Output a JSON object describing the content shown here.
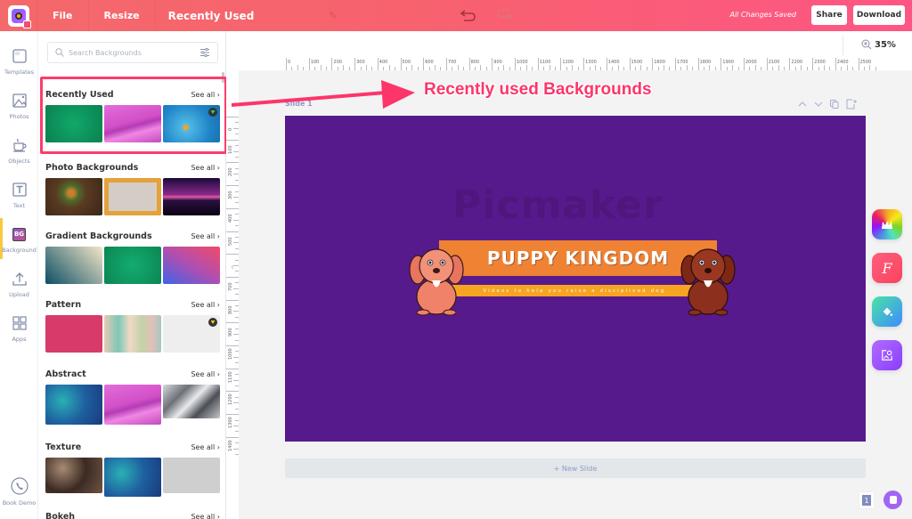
{
  "topbar": {
    "menu": [
      "File",
      "Resize"
    ],
    "title": "Recently Used",
    "save_status": "All Changes Saved",
    "share_label": "Share",
    "download_label": "Download",
    "brand_gradient": [
      "#f4696b",
      "#fe5684"
    ]
  },
  "leftnav": {
    "items": [
      {
        "label": "Templates",
        "icon": "templates-icon"
      },
      {
        "label": "Photos",
        "icon": "photos-icon"
      },
      {
        "label": "Objects",
        "icon": "objects-icon"
      },
      {
        "label": "Text",
        "icon": "text-icon"
      },
      {
        "label": "Background",
        "icon": "background-icon",
        "badge": "BG",
        "active": true
      },
      {
        "label": "Upload",
        "icon": "upload-icon"
      },
      {
        "label": "Apps",
        "icon": "apps-icon"
      }
    ],
    "book_demo": "Book Demo",
    "active_color": "#f8c93e"
  },
  "panel": {
    "search_placeholder": "Search Backgrounds",
    "see_all": "See all",
    "sections": [
      {
        "title": "Recently Used",
        "thumbs": [
          "green-gradient",
          "pink-dunes",
          "blue-3d-premium"
        ]
      },
      {
        "title": "Photo Backgrounds",
        "thumbs": [
          "wood-food",
          "leaf-frame",
          "purple-sunset"
        ]
      },
      {
        "title": "Gradient Backgrounds",
        "thumbs": [
          "teal-cream",
          "green-radial",
          "pink-blue"
        ]
      },
      {
        "title": "Pattern",
        "thumbs": [
          "pink-texture",
          "paint-drips",
          "white-paper-premium"
        ]
      },
      {
        "title": "Abstract",
        "thumbs": [
          "blue-paint",
          "pink-dunes",
          "silver-polygons"
        ]
      },
      {
        "title": "Texture",
        "thumbs": [
          "firewood",
          "blue-paint",
          "grey-concrete"
        ]
      },
      {
        "title": "Bokeh",
        "thumbs": []
      }
    ]
  },
  "workspace": {
    "zoom": "35%",
    "hruler": [
      "0",
      "100",
      "200",
      "300",
      "400",
      "500",
      "600",
      "700",
      "800",
      "900",
      "1000",
      "1100",
      "1200",
      "1300",
      "1400",
      "1500",
      "1600",
      "1700",
      "1800",
      "1900",
      "2000",
      "2100",
      "2200",
      "2300",
      "2400",
      "2500"
    ],
    "vruler": [
      "0",
      "100",
      "200",
      "300",
      "400",
      "500",
      "?",
      "700",
      "800",
      "900",
      "1000",
      "1100",
      "1200",
      "1300",
      "1400"
    ],
    "slide_label": "Slide 1",
    "new_slide": "+ New Slide",
    "page_count": "1",
    "canvas_bg": "#561a8c"
  },
  "design": {
    "watermark": "Picmaker",
    "title": "PUPPY KINGDOM",
    "subtitle": "Videos to help you raise a disciplined dog"
  },
  "annotation": {
    "text": "Recently used Backgrounds",
    "color": "#fc356a"
  }
}
